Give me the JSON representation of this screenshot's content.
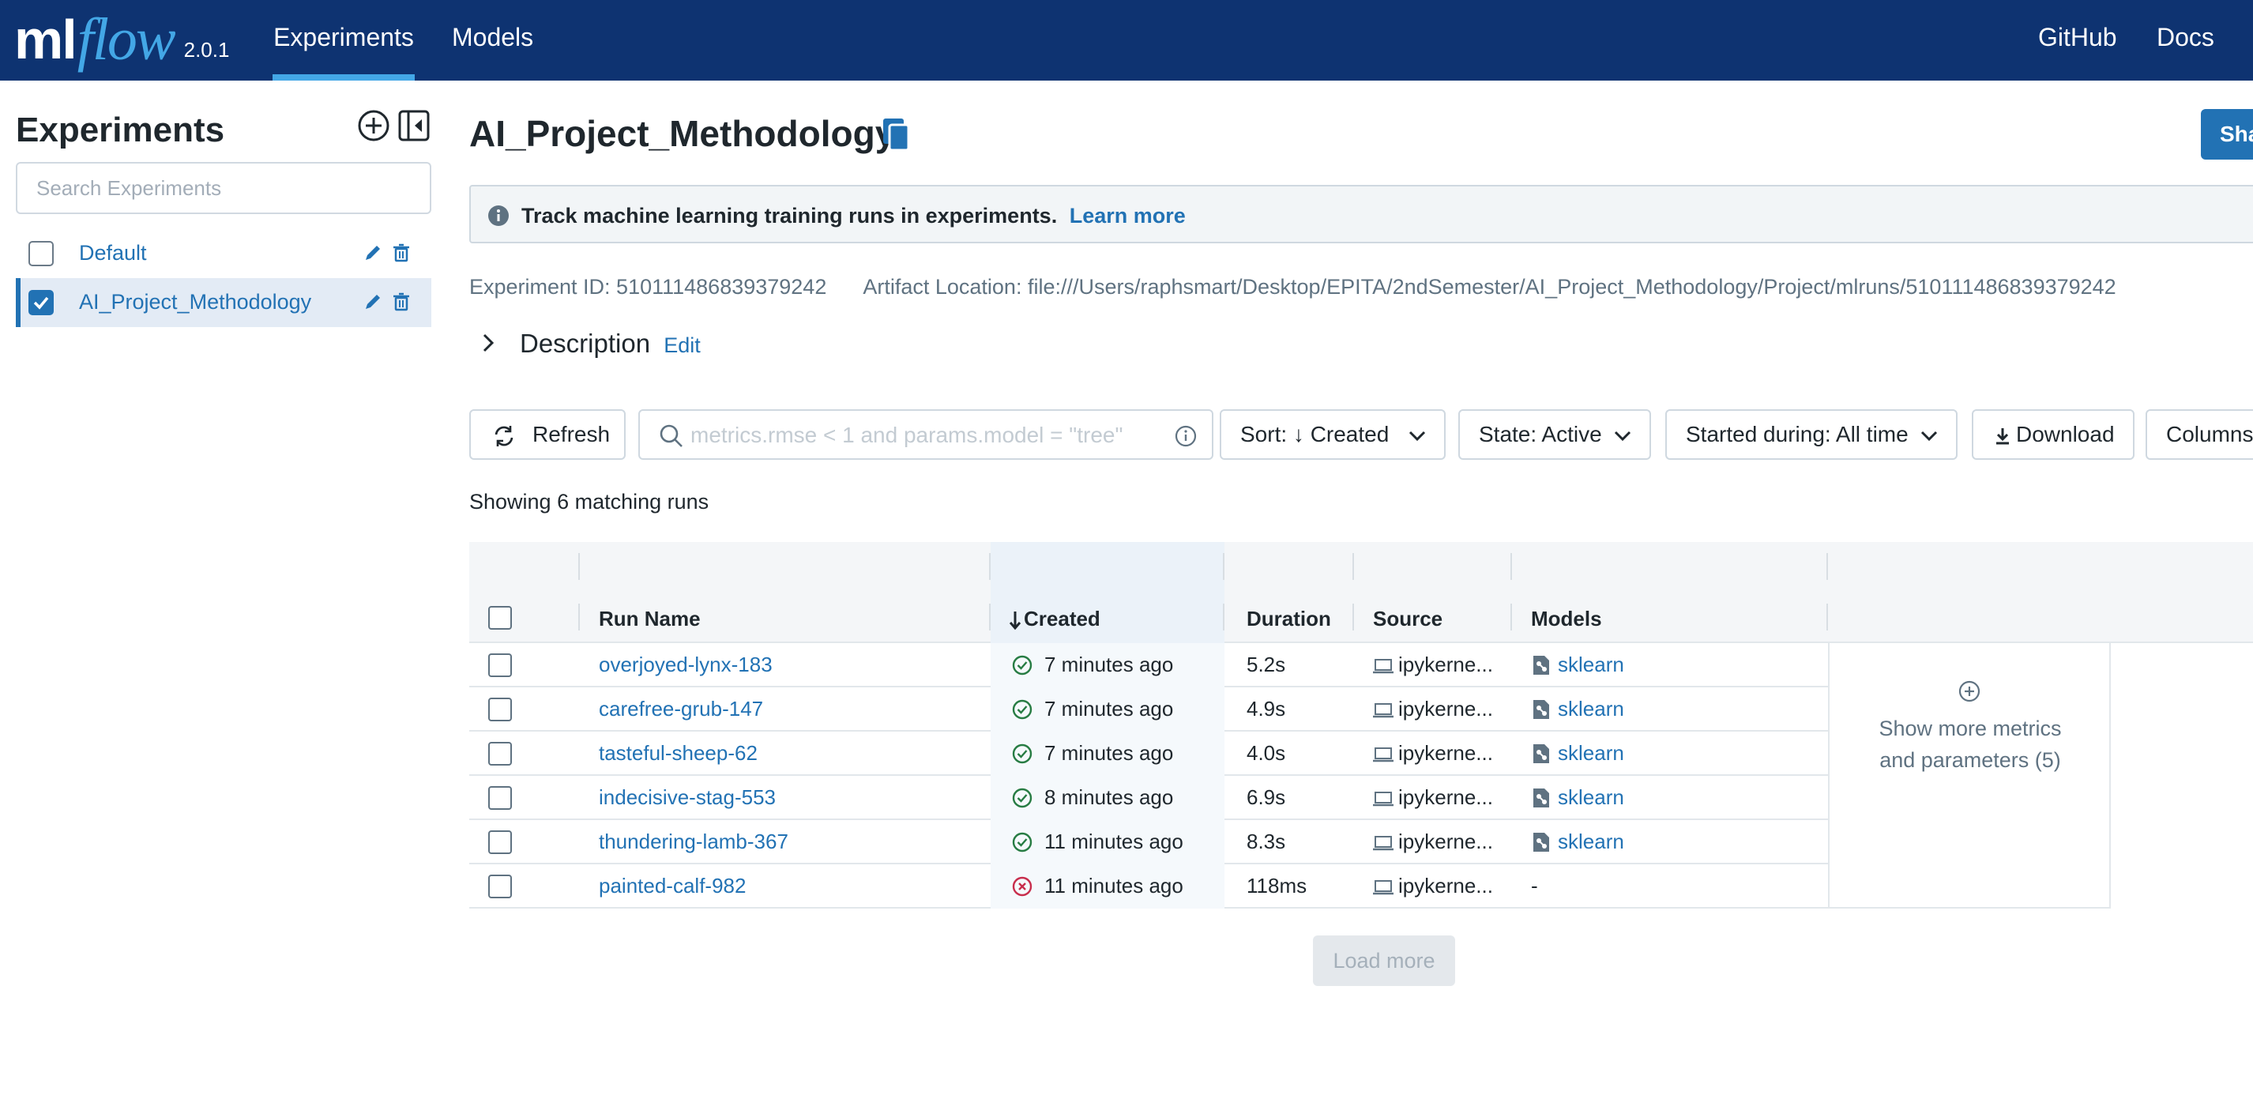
{
  "header": {
    "logo_ml": "ml",
    "logo_flow": "flow",
    "version": "2.0.1",
    "nav": [
      {
        "label": "Experiments",
        "active": true
      },
      {
        "label": "Models",
        "active": false
      }
    ],
    "github": "GitHub",
    "docs": "Docs",
    "colors": {
      "bar": "#0e3371",
      "accent": "#43a7e6"
    }
  },
  "sidebar": {
    "title": "Experiments",
    "search_placeholder": "Search Experiments",
    "experiments": [
      {
        "name": "Default",
        "checked": false
      },
      {
        "name": "AI_Project_Methodology",
        "checked": true
      }
    ]
  },
  "main": {
    "title": "AI_Project_Methodology",
    "share_label": "Sha",
    "banner": {
      "text": "Track machine learning training runs in experiments.",
      "link": "Learn more"
    },
    "experiment_id": "Experiment ID: 510111486839379242",
    "artifact_location": "Artifact Location: file:///Users/raphsmart/Desktop/EPITA/2ndSemester/AI_Project_Methodology/Project/mlruns/510111486839379242",
    "description_label": "Description",
    "description_edit": "Edit",
    "toolbar": {
      "refresh": "Refresh",
      "search_placeholder": "metrics.rmse < 1 and params.model = \"tree\"",
      "sort": "Sort: ↓ Created",
      "state": "State: Active",
      "started": "Started during: All time",
      "download": "Download",
      "columns": "Columns"
    },
    "showing": "Showing 6 matching runs",
    "table": {
      "headers": {
        "run_name": "Run Name",
        "created": "Created",
        "duration": "Duration",
        "source": "Source",
        "models": "Models"
      },
      "rows": [
        {
          "run": "overjoyed-lynx-183",
          "status": "finished",
          "created": "7 minutes ago",
          "duration": "5.2s",
          "source": "ipykerne...",
          "model": "sklearn"
        },
        {
          "run": "carefree-grub-147",
          "status": "finished",
          "created": "7 minutes ago",
          "duration": "4.9s",
          "source": "ipykerne...",
          "model": "sklearn"
        },
        {
          "run": "tasteful-sheep-62",
          "status": "finished",
          "created": "7 minutes ago",
          "duration": "4.0s",
          "source": "ipykerne...",
          "model": "sklearn"
        },
        {
          "run": "indecisive-stag-553",
          "status": "finished",
          "created": "8 minutes ago",
          "duration": "6.9s",
          "source": "ipykerne...",
          "model": "sklearn"
        },
        {
          "run": "thundering-lamb-367",
          "status": "finished",
          "created": "11 minutes ago",
          "duration": "8.3s",
          "source": "ipykerne...",
          "model": "sklearn"
        },
        {
          "run": "painted-calf-982",
          "status": "failed",
          "created": "11 minutes ago",
          "duration": "118ms",
          "source": "ipykerne...",
          "model": "-"
        }
      ]
    },
    "more_columns": {
      "line1": "Show more metrics",
      "line2": "and parameters (5)"
    },
    "load_more": "Load more",
    "colors": {
      "link": "#2272b4",
      "success": "#277c43",
      "error": "#c82d4c"
    }
  }
}
